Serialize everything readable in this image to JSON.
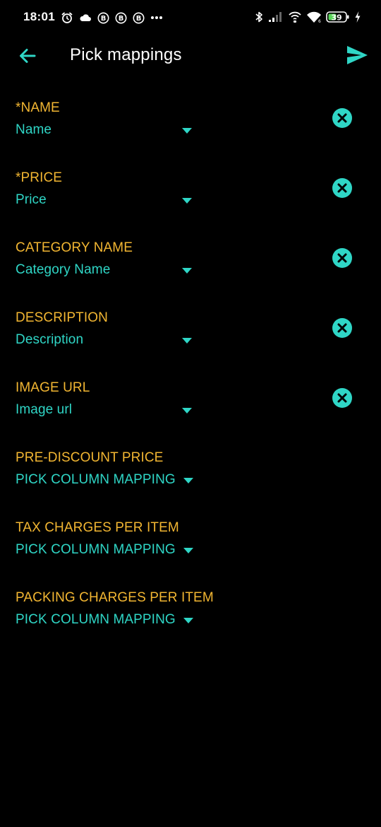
{
  "status_bar": {
    "time": "18:01",
    "battery": "39",
    "left_icons": [
      "alarm-icon",
      "cloud-icon",
      "b-badge-icon",
      "b-badge-icon",
      "b-badge-icon",
      "more-dots-icon"
    ],
    "right_icons": [
      "bluetooth-icon",
      "cell-signal-icon",
      "hotspot-icon",
      "wifi-icon",
      "battery-icon",
      "charging-icon"
    ]
  },
  "app_bar": {
    "title": "Pick mappings",
    "back_icon": "arrow-back-icon",
    "send_icon": "send-icon"
  },
  "mappings": [
    {
      "label": "*NAME",
      "value": "Name",
      "clearable": true
    },
    {
      "label": "*PRICE",
      "value": "Price",
      "clearable": true
    },
    {
      "label": "CATEGORY NAME",
      "value": "Category Name",
      "clearable": true
    },
    {
      "label": "DESCRIPTION",
      "value": "Description",
      "clearable": true
    },
    {
      "label": "IMAGE URL",
      "value": "Image url",
      "clearable": true
    },
    {
      "label": "PRE-DISCOUNT PRICE",
      "value": "PICK COLUMN MAPPING",
      "clearable": false
    },
    {
      "label": "TAX CHARGES PER ITEM",
      "value": "PICK COLUMN MAPPING",
      "clearable": false
    },
    {
      "label": "PACKING CHARGES PER ITEM",
      "value": "PICK COLUMN MAPPING",
      "clearable": false
    }
  ],
  "colors": {
    "background": "#000000",
    "label": "#f2b632",
    "accent": "#2fd6c6",
    "title": "#ffffff"
  }
}
